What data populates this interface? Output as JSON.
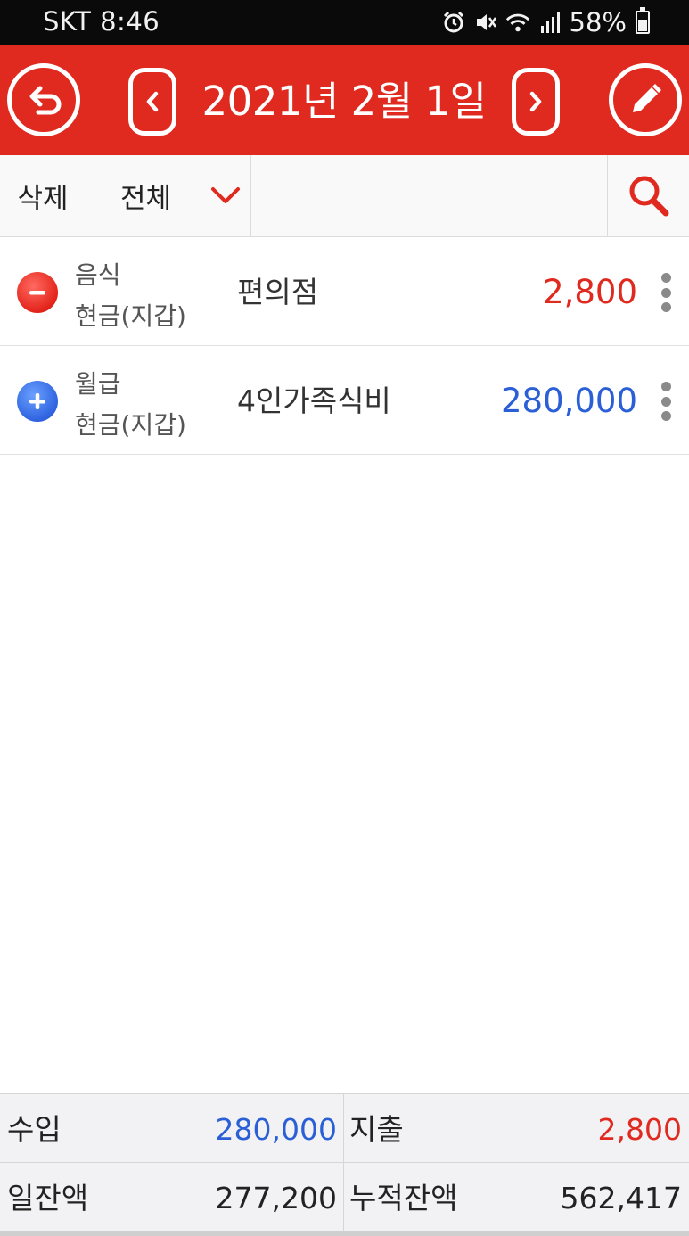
{
  "status_bar": {
    "carrier_time": "SKT 8:46",
    "battery": "58%",
    "battery_level": 0.58,
    "icons": [
      "alarm-icon",
      "mute-icon",
      "wifi-icon",
      "signal-icon",
      "battery-icon"
    ]
  },
  "header": {
    "date": "2021년 2월 1일",
    "accent": "#e0291f",
    "icons": [
      "back-icon",
      "chevron-left-icon",
      "chevron-right-icon",
      "pencil-icon"
    ]
  },
  "toolbar": {
    "delete_label": "삭제",
    "filter_value": "전체",
    "icons": [
      "chevron-down-icon",
      "search-icon"
    ]
  },
  "transactions": [
    {
      "type": "expense",
      "category": "음식",
      "account": "현금(지갑)",
      "memo": "편의점",
      "amount": "2,800",
      "icon": "minus-circle-icon",
      "color": "#e0291f"
    },
    {
      "type": "income",
      "category": "월급",
      "account": "현금(지갑)",
      "memo": "4인가족식비",
      "amount": "280,000",
      "icon": "plus-circle-icon",
      "color": "#2a5fd6"
    }
  ],
  "summary": {
    "income_label": "수입",
    "income_value": "280,000",
    "expense_label": "지출",
    "expense_value": "2,800",
    "daily_balance_label": "일잔액",
    "daily_balance_value": "277,200",
    "cumulative_balance_label": "누적잔액",
    "cumulative_balance_value": "562,417"
  }
}
